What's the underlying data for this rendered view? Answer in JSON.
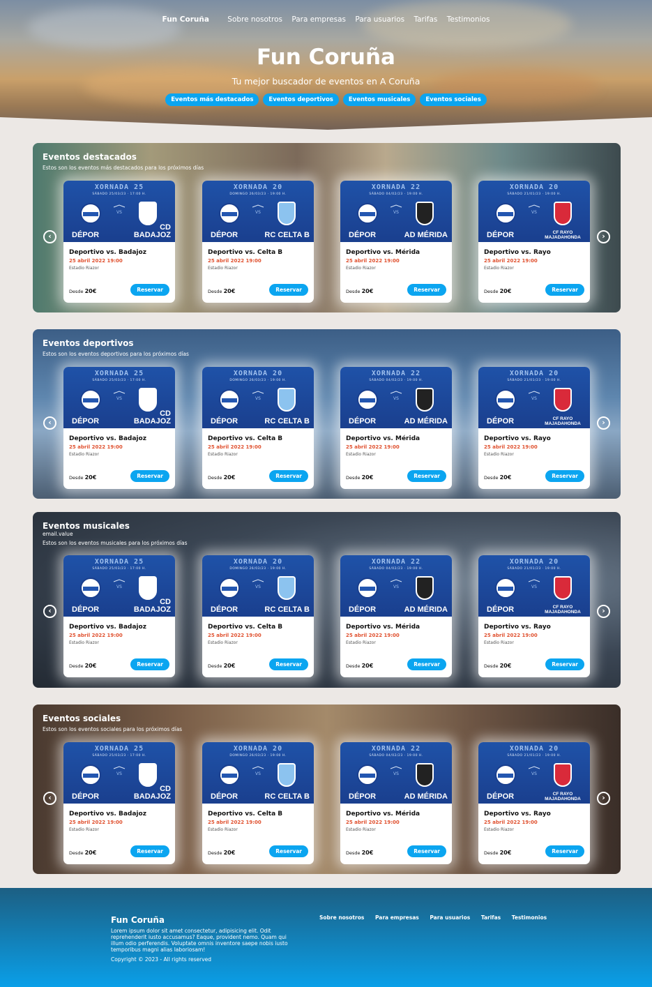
{
  "nav": {
    "brand": "Fun Coruña",
    "links": [
      "Sobre nosotros",
      "Para empresas",
      "Para usuarios",
      "Tarifas",
      "Testimonios"
    ]
  },
  "hero": {
    "title": "Fun Coruña",
    "subtitle": "Tu mejor buscador de eventos en A Coruña",
    "pills": [
      "Eventos más destacados",
      "Eventos deportivos",
      "Eventos musicales",
      "Eventos sociales"
    ]
  },
  "sections": [
    {
      "title": "Eventos destacados",
      "subtitle": "Estos son los eventos más destacados para los próximos días",
      "extra": ""
    },
    {
      "title": "Eventos deportivos",
      "subtitle": "Estos son los eventos deportivos para los próximos días",
      "extra": ""
    },
    {
      "title": "Eventos musicales",
      "subtitle": "Estos son los eventos musicales para los próximos días",
      "extra": "email.value"
    },
    {
      "title": "Eventos sociales",
      "subtitle": "Estos son los eventos sociales para los próximos días",
      "extra": ""
    }
  ],
  "events": [
    {
      "jornada": "XORNADA 25",
      "date": "SÁBADO 25/03/23 · 17:00 H.",
      "home": "DÉPOR",
      "away": "CD BADAJOZ",
      "name": "Deportivo vs. Badajoz",
      "when": "25 abril 2022 19:00",
      "place": "Estadio Riazor",
      "price_label": "Desde",
      "price": "20€",
      "button": "Reservar",
      "rival_color": "#ffffff"
    },
    {
      "jornada": "XORNADA 20",
      "date": "DOMINGO 26/03/23 · 19:00 H.",
      "home": "DÉPOR",
      "away": "RC CELTA B",
      "name": "Deportivo vs. Celta B",
      "when": "25 abril 2022 19:00",
      "place": "Estadio Riazor",
      "price_label": "Desde",
      "price": "20€",
      "button": "Reservar",
      "rival_color": "#8cc3ef"
    },
    {
      "jornada": "XORNADA 22",
      "date": "SÁBADO 04/02/23 · 19:00 H.",
      "home": "DÉPOR",
      "away": "AD MÉRIDA",
      "name": "Deportivo vs. Mérida",
      "when": "25 abril 2022 19:00",
      "place": "Estadio Riazor",
      "price_label": "Desde",
      "price": "20€",
      "button": "Reservar",
      "rival_color": "#222222"
    },
    {
      "jornada": "XORNADA 20",
      "date": "SÁBADO 21/01/23 · 19:00 H.",
      "home": "DÉPOR",
      "away": "CF RAYO MAJADAHONDA",
      "name": "Deportivo vs. Rayo",
      "when": "25 abril 2022 19:00",
      "place": "Estadio Riazor",
      "price_label": "Desde",
      "price": "20€",
      "button": "Reservar",
      "rival_color": "#d92a3a"
    }
  ],
  "footer": {
    "brand": "Fun Coruña",
    "text": "Lorem ipsum dolor sit amet consectetur, adipisicing elit. Odit reprehenderit iusto accusamus? Eaque, provident nemo. Quam qui illum odio perferendis. Voluptate omnis inventore saepe nobis iusto temporibus magni alias laboriosam!",
    "copyright": "Copyright © 2023 - All rights reserved",
    "links": [
      "Sobre nosotros",
      "Para empresas",
      "Para usuarios",
      "Tarifas",
      "Testimonios"
    ]
  }
}
